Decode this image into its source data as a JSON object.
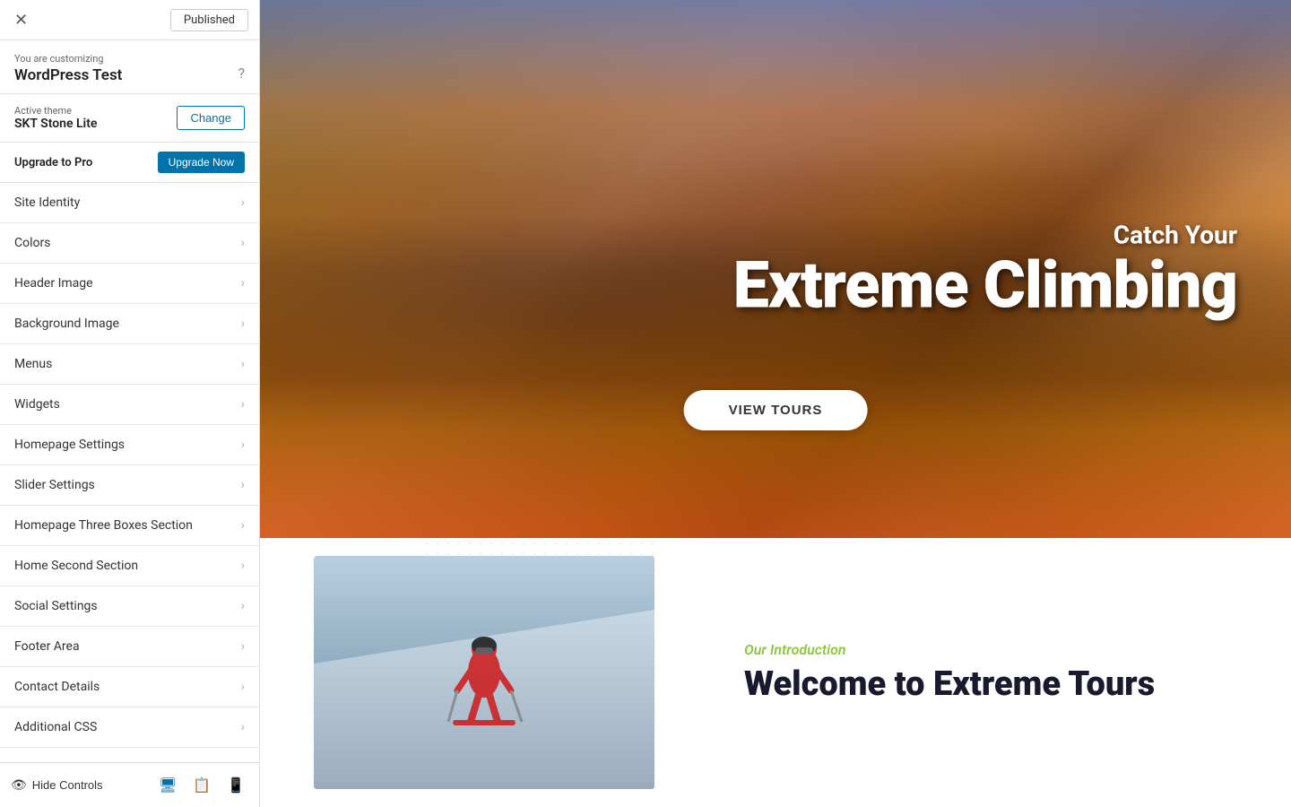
{
  "topbar": {
    "close_label": "✕",
    "published_label": "Published"
  },
  "customizing": {
    "label": "You are customizing",
    "title": "WordPress Test"
  },
  "active_theme": {
    "label": "Active theme",
    "name": "SKT Stone Lite",
    "change_button": "Change"
  },
  "upgrade": {
    "label": "Upgrade to Pro",
    "button": "Upgrade Now"
  },
  "menu_items": [
    {
      "id": "site-identity",
      "label": "Site Identity"
    },
    {
      "id": "colors",
      "label": "Colors"
    },
    {
      "id": "header-image",
      "label": "Header Image"
    },
    {
      "id": "background-image",
      "label": "Background Image"
    },
    {
      "id": "menus",
      "label": "Menus"
    },
    {
      "id": "widgets",
      "label": "Widgets"
    },
    {
      "id": "homepage-settings",
      "label": "Homepage Settings"
    },
    {
      "id": "slider-settings",
      "label": "Slider Settings"
    },
    {
      "id": "homepage-three-boxes",
      "label": "Homepage Three Boxes Section"
    },
    {
      "id": "home-second-section",
      "label": "Home Second Section"
    },
    {
      "id": "social-settings",
      "label": "Social Settings"
    },
    {
      "id": "footer-area",
      "label": "Footer Area"
    },
    {
      "id": "contact-details",
      "label": "Contact Details"
    },
    {
      "id": "additional-css",
      "label": "Additional CSS"
    }
  ],
  "bottom_bar": {
    "hide_controls": "Hide Controls",
    "device_desktop": "desktop",
    "device_tablet": "tablet",
    "device_mobile": "mobile"
  },
  "hero": {
    "catch_line": "Catch Your",
    "main_title": "Extreme Climbing",
    "cta_button": "VIEW TOURS"
  },
  "intro": {
    "subtitle": "Our Introduction",
    "title": "Welcome to Extreme Tours"
  }
}
